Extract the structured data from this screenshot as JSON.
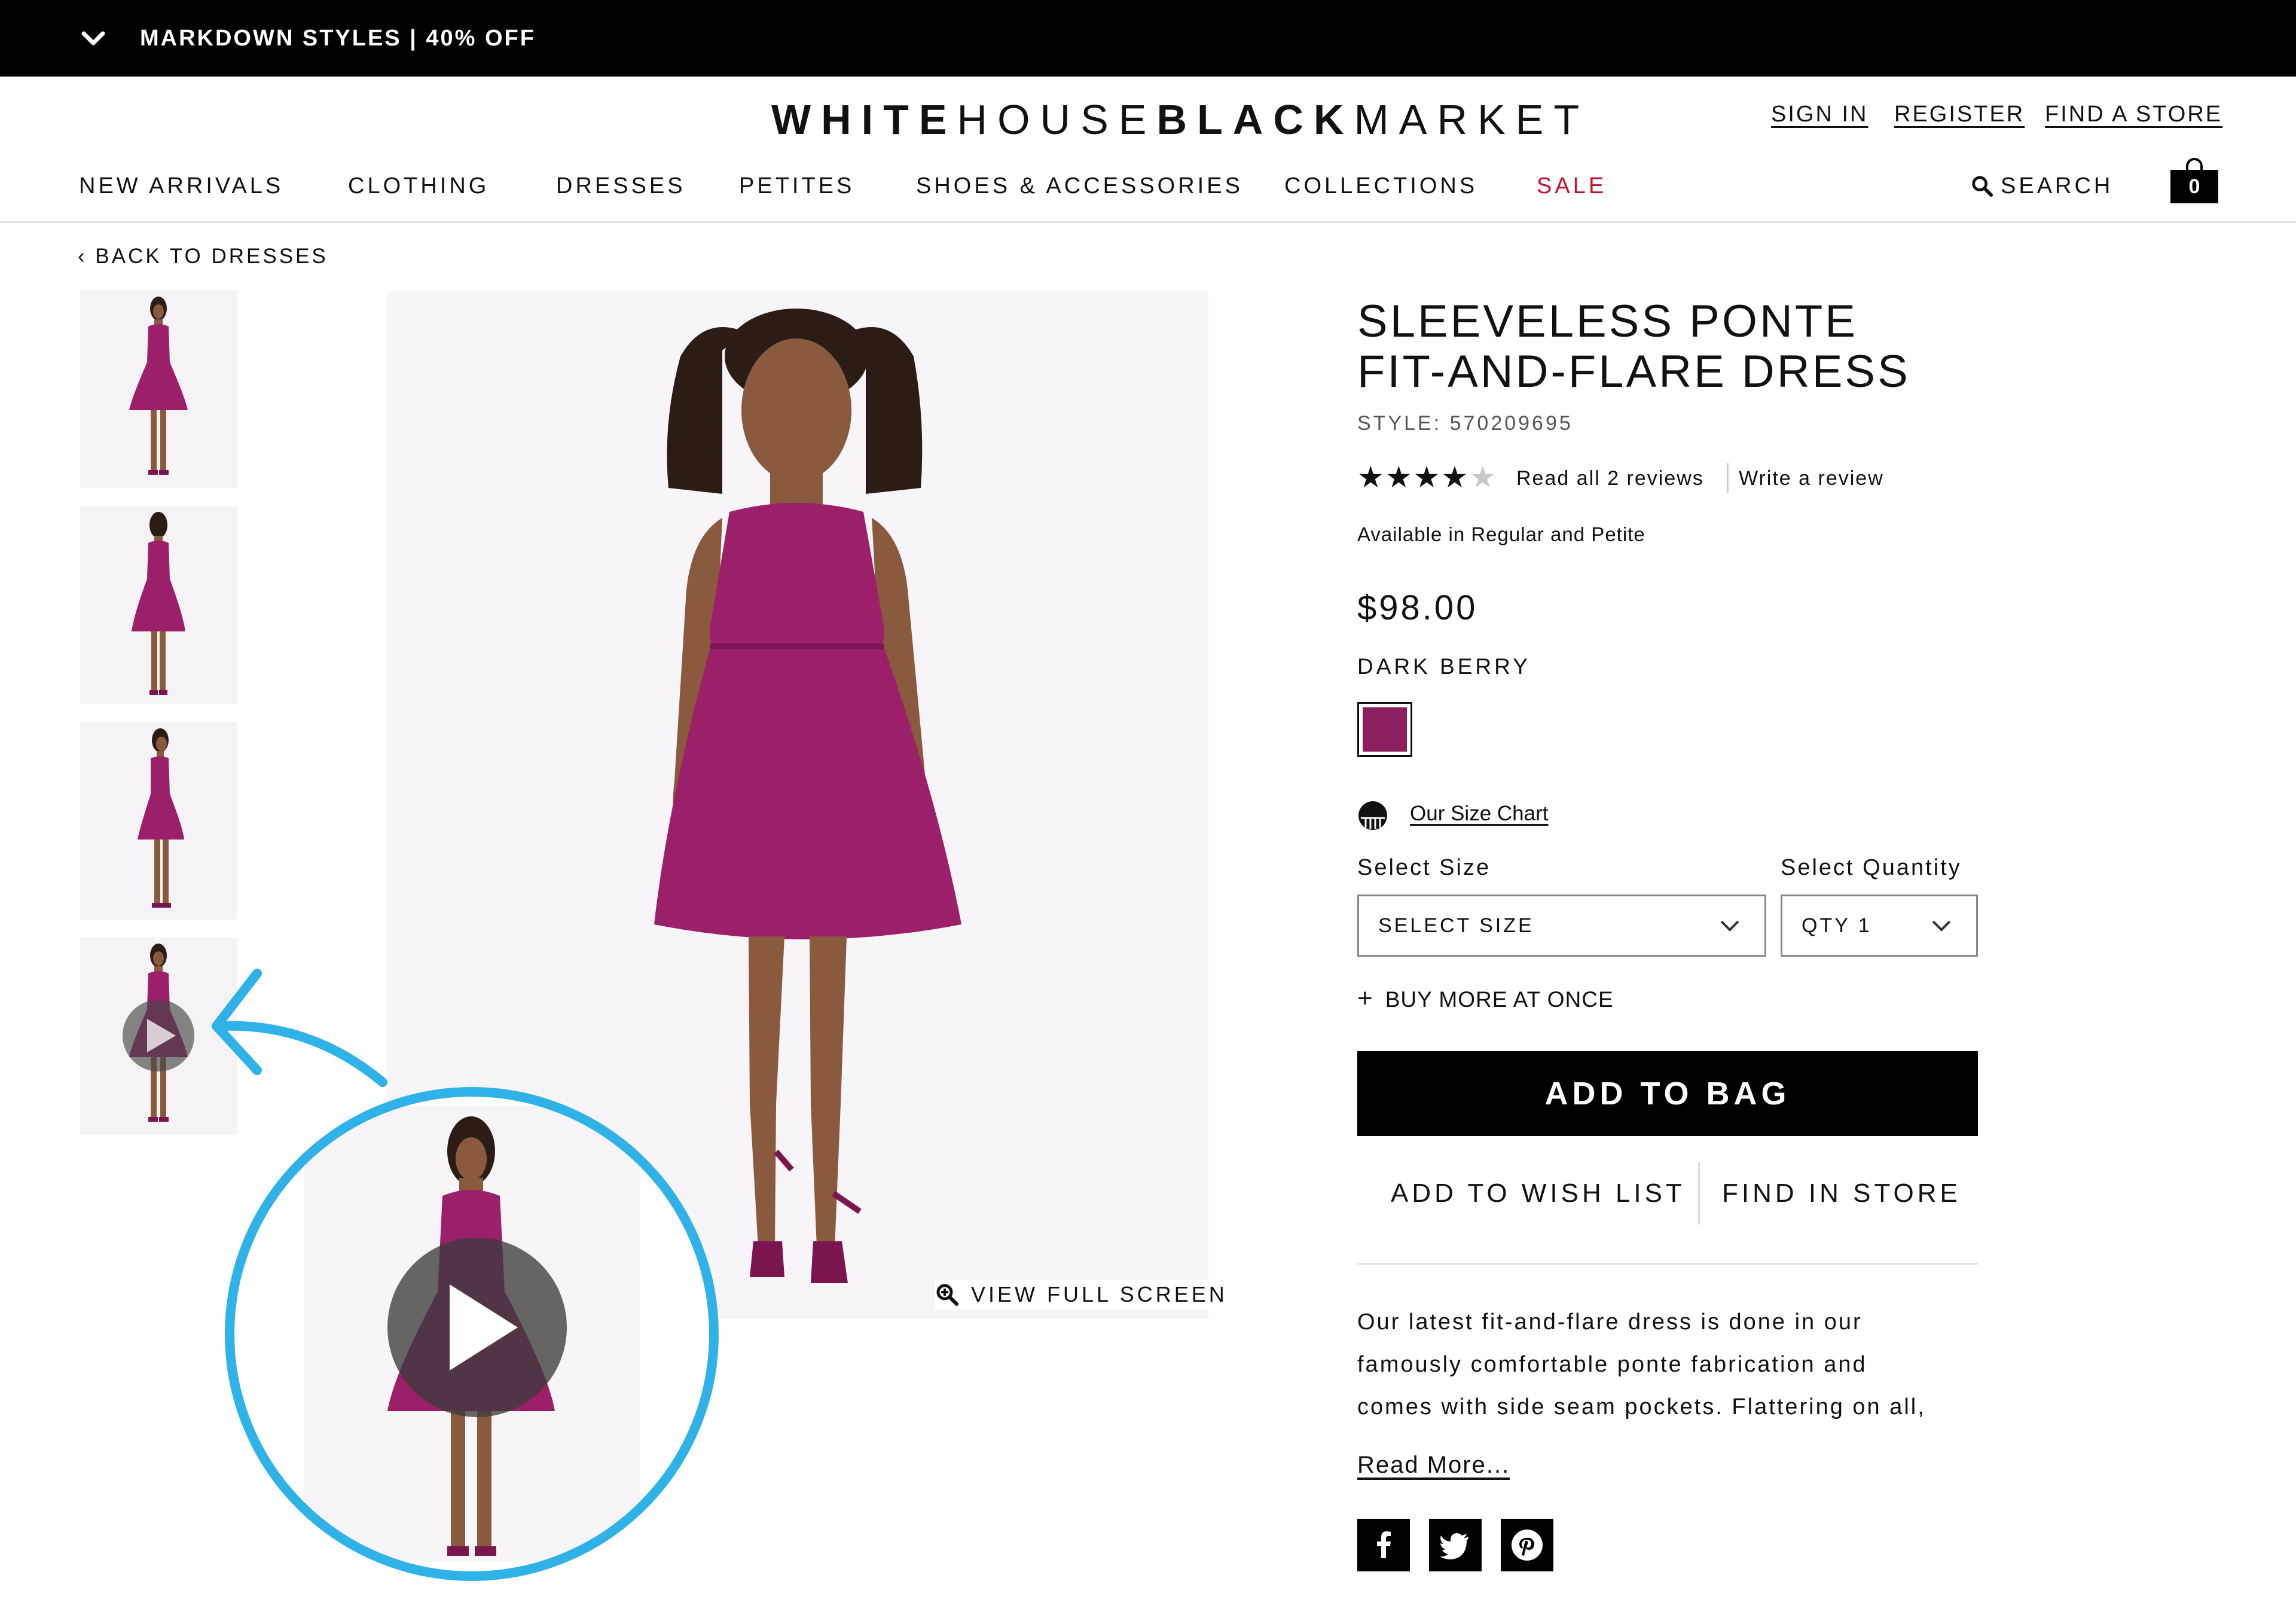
{
  "promo": {
    "text": "MARKDOWN STYLES | 40% OFF",
    "toggle_icon": "chevron-down-icon"
  },
  "header": {
    "logo": {
      "white": "WHITE",
      "house": "HOUSE",
      "black": "BLACK",
      "market": "MARKET"
    },
    "utility_links": {
      "sign_in": "SIGN IN",
      "register": "REGISTER",
      "find_store": "FIND A STORE"
    },
    "nav": [
      {
        "label": "NEW ARRIVALS"
      },
      {
        "label": "CLOTHING"
      },
      {
        "label": "DRESSES"
      },
      {
        "label": "PETITES"
      },
      {
        "label": "SHOES & ACCESSORIES"
      },
      {
        "label": "COLLECTIONS"
      },
      {
        "label": "SALE"
      }
    ],
    "search_label": "SEARCH",
    "bag_count": "0"
  },
  "breadcrumb": {
    "back_label": "‹ BACK TO DRESSES"
  },
  "gallery": {
    "view_full_screen": "VIEW FULL SCREEN",
    "thumbnail_count": 4,
    "video_thumbnail_index": 4
  },
  "product": {
    "title": "SLEEVELESS PONTE FIT-AND-FLARE DRESS",
    "style": "STYLE: 570209695",
    "rating": 4,
    "rating_max": 5,
    "read_reviews": "Read all 2 reviews",
    "write_review": "Write a review",
    "availability": "Available in Regular and Petite",
    "price": "$98.00",
    "color_name": "DARK BERRY",
    "color_hex": "#8b1e5e",
    "size_chart": "Our Size Chart",
    "select_size_label": "Select Size",
    "select_size_value": "SELECT SIZE",
    "select_quantity_label": "Select Quantity",
    "select_quantity_value": "QTY 1",
    "buy_more": "BUY MORE AT ONCE",
    "add_to_bag": "ADD TO BAG",
    "add_to_wish_list": "ADD TO WISH LIST",
    "find_in_store": "FIND IN STORE",
    "description_lines": [
      "Our latest fit-and-flare dress is done in our",
      "famously comfortable ponte fabrication and",
      "comes with side seam pockets. Flattering on all,"
    ],
    "read_more": "Read More..."
  },
  "social": [
    "facebook-icon",
    "twitter-icon",
    "pinterest-icon"
  ],
  "colors": {
    "sale_red": "#c8102e",
    "annotation_blue": "#2eb2e8",
    "dress": "#9c1f6a"
  }
}
